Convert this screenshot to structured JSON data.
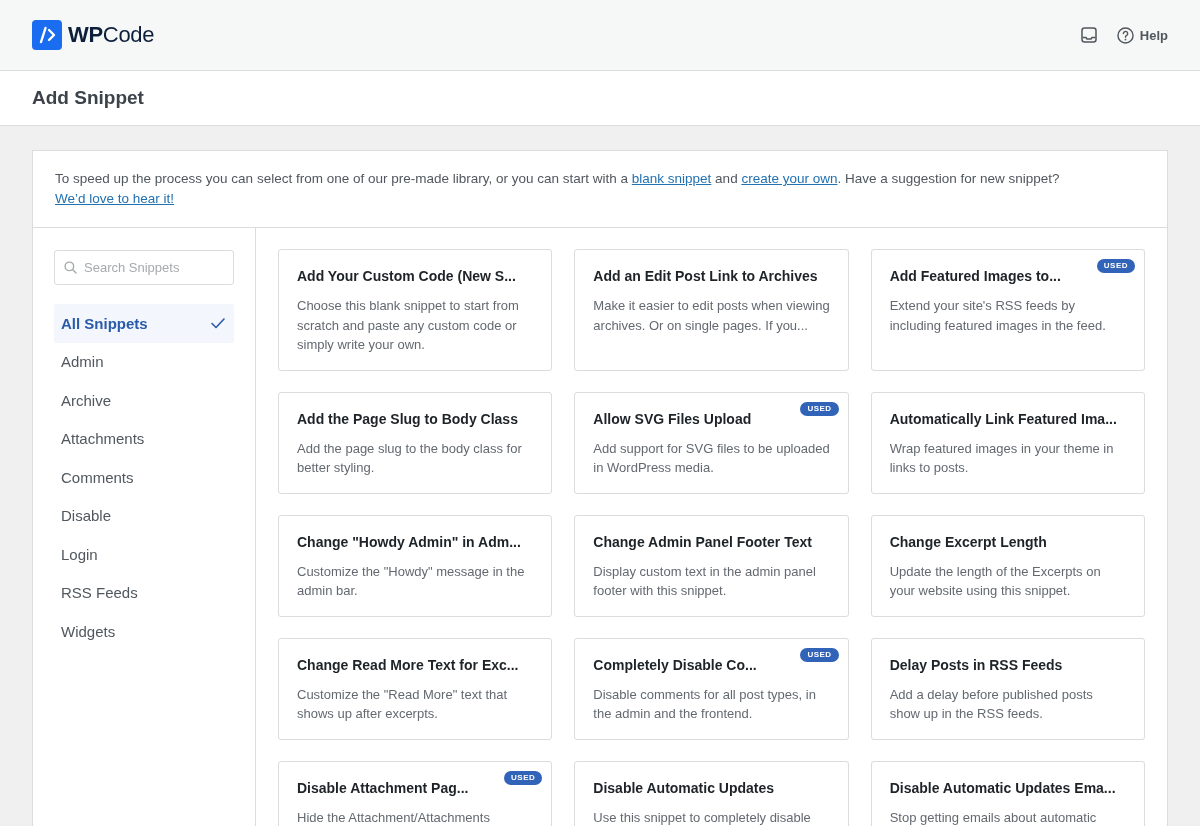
{
  "header": {
    "logo": "**WP**Code",
    "help_label": "Help"
  },
  "page_title": "Add Snippet",
  "intro": [
    {
      "kind": "text",
      "text": "To speed up the process you can select from one of our pre-made library, or you can start with a "
    },
    {
      "kind": "link",
      "text": "blank snippet"
    },
    {
      "kind": "text",
      "text": " and "
    },
    {
      "kind": "link",
      "text": "create your own"
    },
    {
      "kind": "text",
      "text": ". Have a suggestion for new snippet? "
    },
    {
      "kind": "link",
      "text": "We’d love to hear it!"
    }
  ],
  "sidebar": {
    "search": {
      "placeholder": "Search Snippets"
    },
    "items": [
      {
        "label": "All Snippets",
        "selected": true
      },
      {
        "label": "Admin",
        "selected": false
      },
      {
        "label": "Archive",
        "selected": false
      },
      {
        "label": "Attachments",
        "selected": false
      },
      {
        "label": "Comments",
        "selected": false
      },
      {
        "label": "Disable",
        "selected": false
      },
      {
        "label": "Login",
        "selected": false
      },
      {
        "label": "RSS Feeds",
        "selected": false
      },
      {
        "label": "Widgets",
        "selected": false
      }
    ]
  },
  "snippets": [
    {
      "title": "Add Your Custom Code (New S...",
      "description": "Choose this blank snippet to start from scratch and paste any custom code or simply write your own."
    },
    {
      "title": "Add an Edit Post Link to Archives",
      "description": "Make it easier to edit posts when viewing archives. Or on single pages. If you..."
    },
    {
      "title": "Add Featured Images to...",
      "description": "Extend your site's RSS feeds by including featured images in the feed.",
      "badge": "USED"
    },
    {
      "title": "Add the Page Slug to Body Class",
      "description": "Add the page slug to the body class for better styling."
    },
    {
      "title": "Allow SVG Files Upload",
      "description": "Add support for SVG files to be uploaded in WordPress media.",
      "badge": "USED"
    },
    {
      "title": "Automatically Link Featured Ima...",
      "description": "Wrap featured images in your theme in links to posts."
    },
    {
      "title": "Change \"Howdy Admin\" in Adm...",
      "description": "Customize the \"Howdy\" message in the admin bar."
    },
    {
      "title": "Change Admin Panel Footer Text",
      "description": "Display custom text in the admin panel footer with this snippet."
    },
    {
      "title": "Change Excerpt Length",
      "description": "Update the length of the Excerpts on your website using this snippet."
    },
    {
      "title": "Change Read More Text for Exc...",
      "description": "Customize the \"Read More\" text that shows up after excerpts."
    },
    {
      "title": "Completely Disable Co...",
      "description": "Disable comments for all post types, in the admin and the frontend.",
      "badge": "USED"
    },
    {
      "title": "Delay Posts in RSS Feeds",
      "description": "Add a delay before published posts show up in the RSS feeds."
    },
    {
      "title": "Disable Attachment Pag...",
      "description": "Hide the Attachment/Attachments",
      "badge": "USED"
    },
    {
      "title": "Disable Automatic Updates",
      "description": "Use this snippet to completely disable"
    },
    {
      "title": "Disable Automatic Updates Ema...",
      "description": "Stop getting emails about automatic"
    }
  ]
}
